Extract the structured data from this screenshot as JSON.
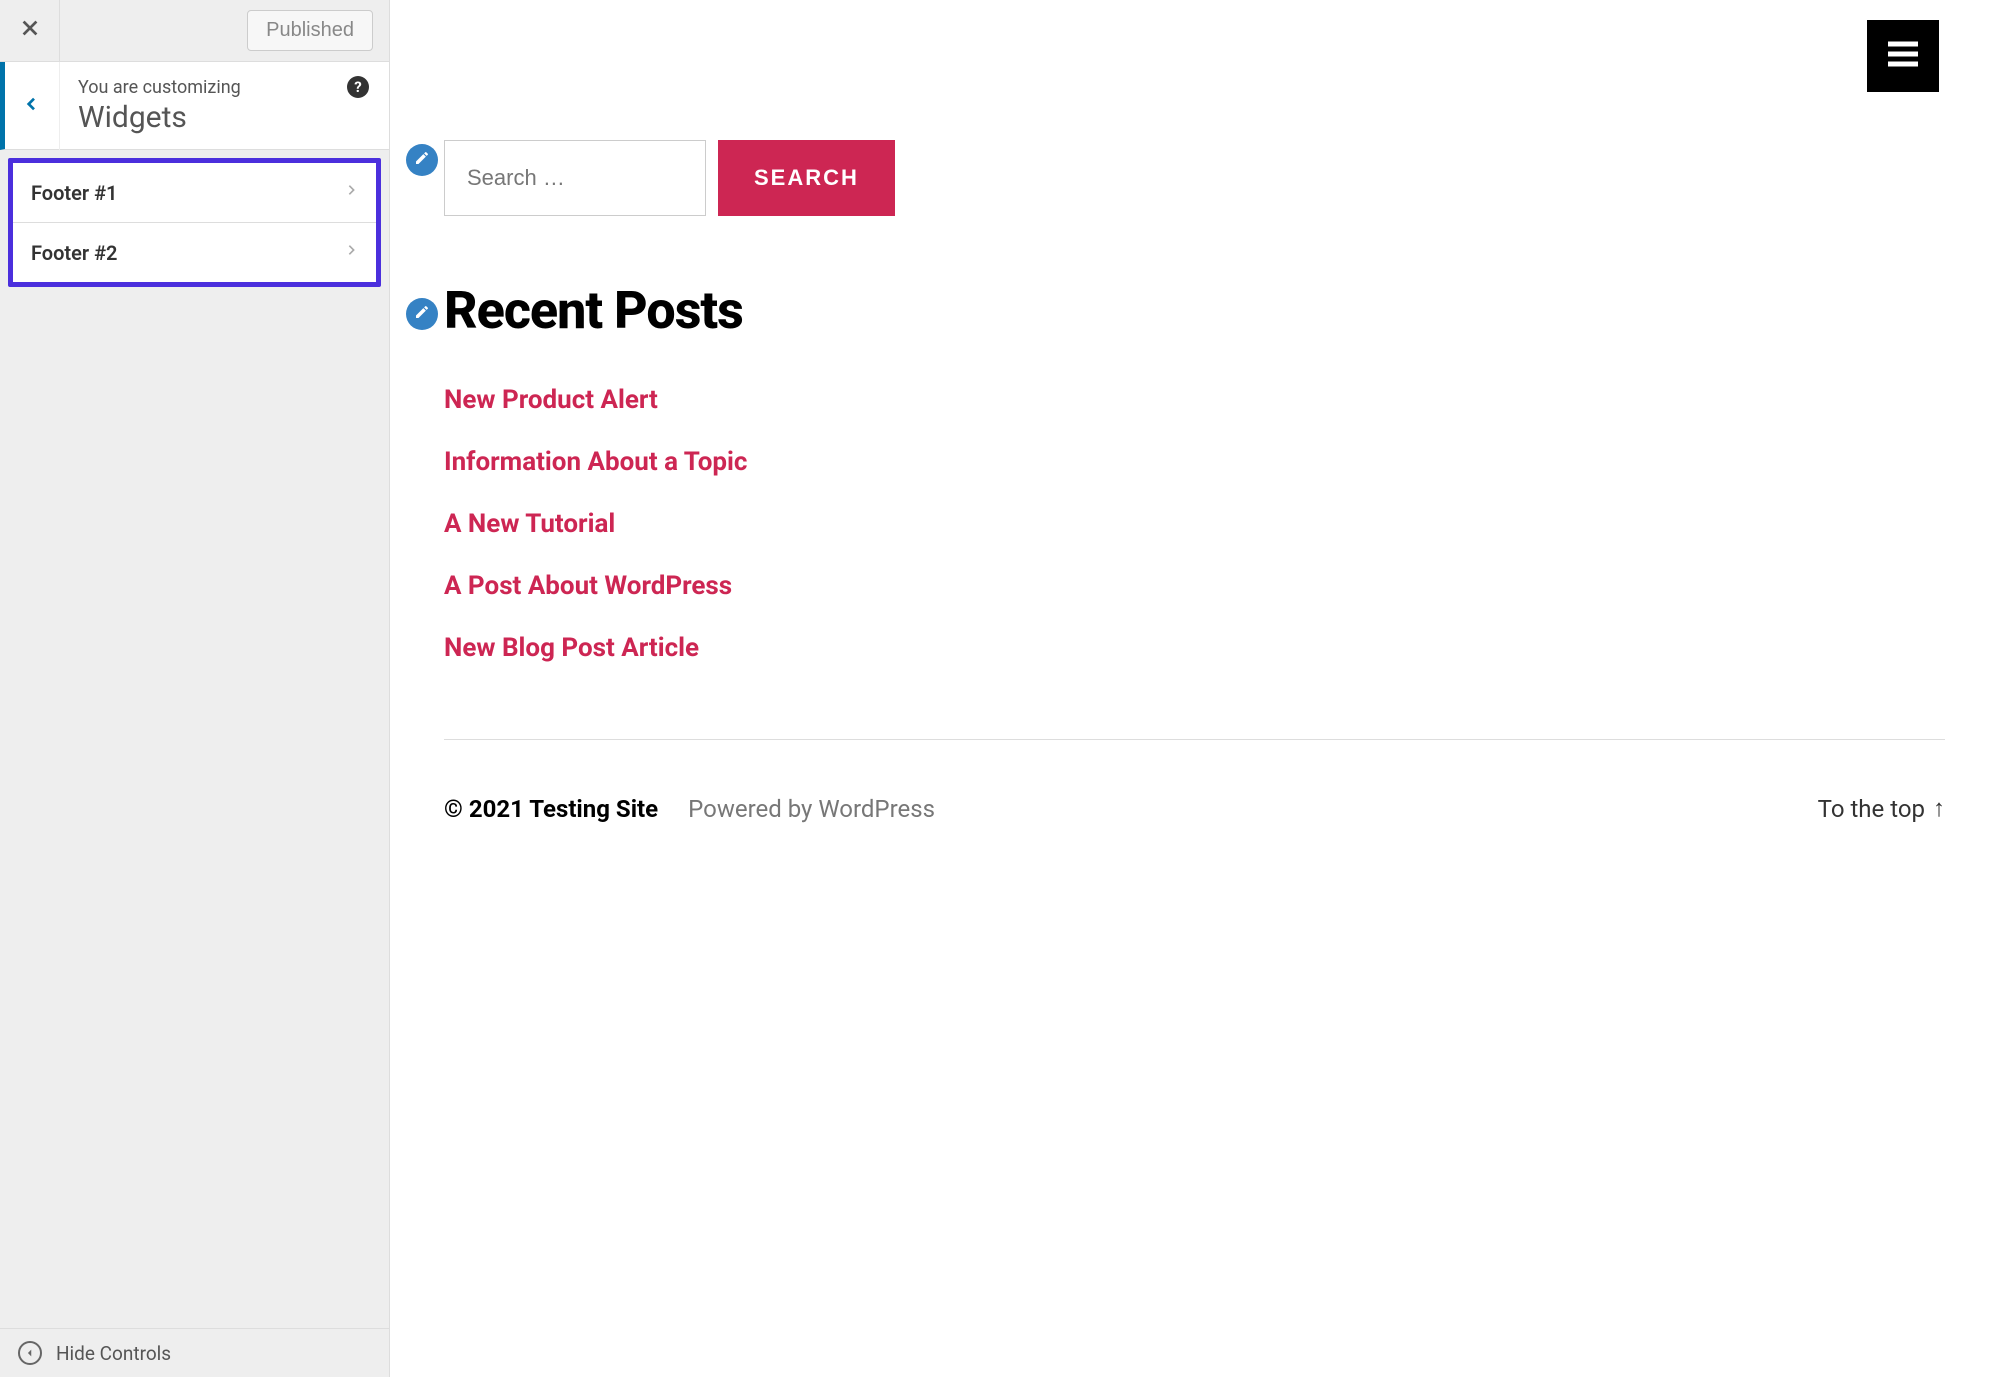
{
  "sidebar": {
    "publish_label": "Published",
    "subheading": "You are customizing",
    "title": "Widgets",
    "sections": [
      {
        "label": "Footer #1"
      },
      {
        "label": "Footer #2"
      }
    ],
    "hide_controls_label": "Hide Controls"
  },
  "preview": {
    "search": {
      "placeholder": "Search …",
      "button_label": "SEARCH"
    },
    "recent": {
      "heading": "Recent Posts",
      "posts": [
        "New Product Alert",
        "Information About a Topic",
        "A New Tutorial",
        "A Post About WordPress",
        "New Blog Post Article"
      ]
    },
    "footer": {
      "copyright": "© 2021 Testing Site",
      "powered": "Powered by WordPress",
      "to_top": "To the top"
    }
  },
  "colors": {
    "accent": "#cd2653",
    "highlight": "#4b2fdd",
    "wp_blue": "#3582c4"
  }
}
